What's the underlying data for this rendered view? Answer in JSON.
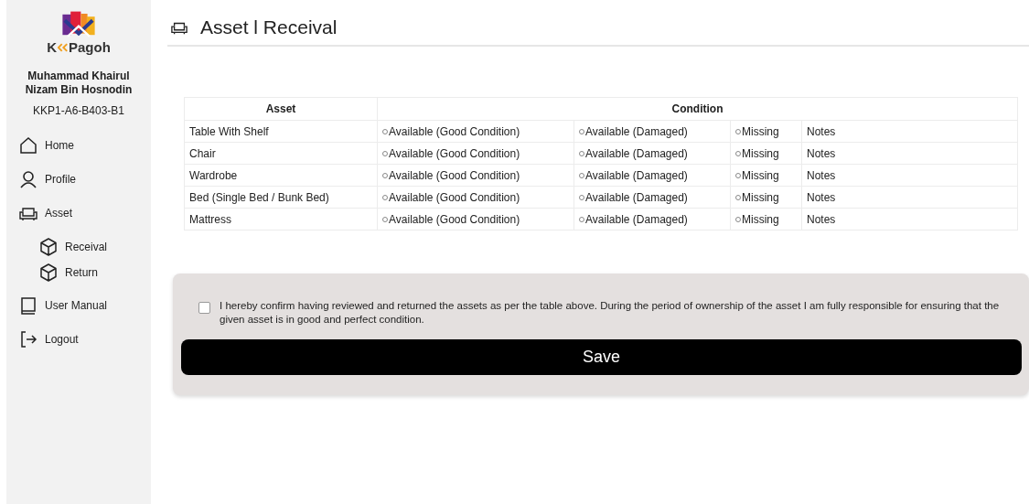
{
  "sidebar": {
    "logo": {
      "text_1": "K",
      "text_2": "Pagoh"
    },
    "user_name": "Muhammad Khairul Nizam Bin Hosnodin",
    "room": "KKP1-A6-B403-B1",
    "items": [
      {
        "label": "Home"
      },
      {
        "label": "Profile"
      },
      {
        "label": "Asset",
        "children": [
          {
            "label": "Receival"
          },
          {
            "label": "Return"
          }
        ]
      },
      {
        "label": "User Manual"
      },
      {
        "label": "Logout"
      }
    ]
  },
  "header": {
    "title": "Asset l Receival"
  },
  "table": {
    "columns": [
      "Asset",
      "Condition"
    ],
    "rows": [
      {
        "asset": "Table With Shelf",
        "options": [
          {
            "label": "Available (Good Condition)",
            "selected": false
          },
          {
            "label": "Available (Damaged)",
            "selected": false
          },
          {
            "label": "Missing",
            "selected": false
          }
        ],
        "notes": "Notes"
      },
      {
        "asset": "Chair",
        "options": [
          {
            "label": "Available (Good Condition)",
            "selected": false
          },
          {
            "label": "Available (Damaged)",
            "selected": false
          },
          {
            "label": "Missing",
            "selected": false
          }
        ],
        "notes": "Notes"
      },
      {
        "asset": "Wardrobe",
        "options": [
          {
            "label": "Available (Good Condition)",
            "selected": false
          },
          {
            "label": "Available (Damaged)",
            "selected": false
          },
          {
            "label": "Missing",
            "selected": false
          }
        ],
        "notes": "Notes"
      },
      {
        "asset": "Bed (Single Bed / Bunk Bed)",
        "options": [
          {
            "label": "Available (Good Condition)",
            "selected": false
          },
          {
            "label": "Available (Damaged)",
            "selected": false
          },
          {
            "label": "Missing",
            "selected": false
          }
        ],
        "notes": "Notes"
      },
      {
        "asset": "Mattress",
        "options": [
          {
            "label": "Available (Good Condition)",
            "selected": false
          },
          {
            "label": "Available (Damaged)",
            "selected": false
          },
          {
            "label": "Missing",
            "selected": false
          }
        ],
        "notes": "Notes"
      }
    ]
  },
  "confirm": {
    "checked": false,
    "text": "I hereby confirm having reviewed and returned the assets as per the table above. During the period of ownership of the asset I am fully responsible for ensuring that the given asset is in good and perfect condition."
  },
  "save_button": "Save"
}
